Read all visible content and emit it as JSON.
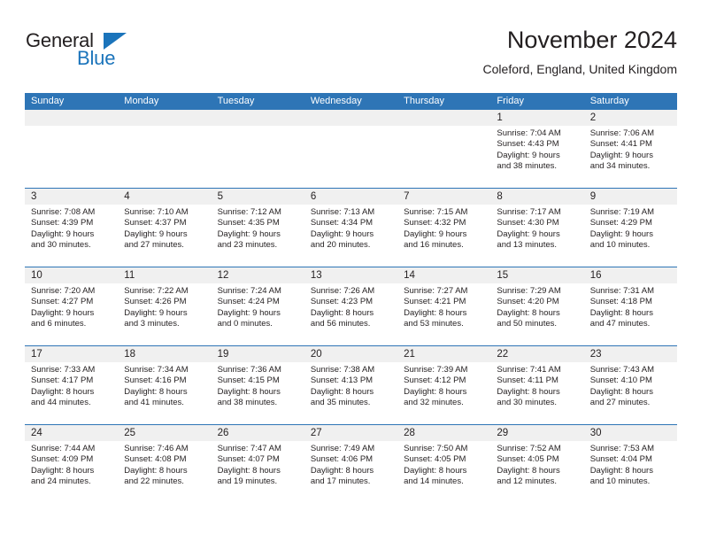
{
  "brand": {
    "name_top": "General",
    "name_bottom": "Blue",
    "accent_color": "#1b74bb"
  },
  "header": {
    "title": "November 2024",
    "location": "Coleford, England, United Kingdom"
  },
  "calendar": {
    "header_color": "#2e75b6",
    "daynum_band_color": "#f0f0f0",
    "day_names": [
      "Sunday",
      "Monday",
      "Tuesday",
      "Wednesday",
      "Thursday",
      "Friday",
      "Saturday"
    ],
    "weeks": [
      [
        {
          "day": "",
          "sunrise": "",
          "sunset": "",
          "daylight1": "",
          "daylight2": ""
        },
        {
          "day": "",
          "sunrise": "",
          "sunset": "",
          "daylight1": "",
          "daylight2": ""
        },
        {
          "day": "",
          "sunrise": "",
          "sunset": "",
          "daylight1": "",
          "daylight2": ""
        },
        {
          "day": "",
          "sunrise": "",
          "sunset": "",
          "daylight1": "",
          "daylight2": ""
        },
        {
          "day": "",
          "sunrise": "",
          "sunset": "",
          "daylight1": "",
          "daylight2": ""
        },
        {
          "day": "1",
          "sunrise": "Sunrise: 7:04 AM",
          "sunset": "Sunset: 4:43 PM",
          "daylight1": "Daylight: 9 hours",
          "daylight2": "and 38 minutes."
        },
        {
          "day": "2",
          "sunrise": "Sunrise: 7:06 AM",
          "sunset": "Sunset: 4:41 PM",
          "daylight1": "Daylight: 9 hours",
          "daylight2": "and 34 minutes."
        }
      ],
      [
        {
          "day": "3",
          "sunrise": "Sunrise: 7:08 AM",
          "sunset": "Sunset: 4:39 PM",
          "daylight1": "Daylight: 9 hours",
          "daylight2": "and 30 minutes."
        },
        {
          "day": "4",
          "sunrise": "Sunrise: 7:10 AM",
          "sunset": "Sunset: 4:37 PM",
          "daylight1": "Daylight: 9 hours",
          "daylight2": "and 27 minutes."
        },
        {
          "day": "5",
          "sunrise": "Sunrise: 7:12 AM",
          "sunset": "Sunset: 4:35 PM",
          "daylight1": "Daylight: 9 hours",
          "daylight2": "and 23 minutes."
        },
        {
          "day": "6",
          "sunrise": "Sunrise: 7:13 AM",
          "sunset": "Sunset: 4:34 PM",
          "daylight1": "Daylight: 9 hours",
          "daylight2": "and 20 minutes."
        },
        {
          "day": "7",
          "sunrise": "Sunrise: 7:15 AM",
          "sunset": "Sunset: 4:32 PM",
          "daylight1": "Daylight: 9 hours",
          "daylight2": "and 16 minutes."
        },
        {
          "day": "8",
          "sunrise": "Sunrise: 7:17 AM",
          "sunset": "Sunset: 4:30 PM",
          "daylight1": "Daylight: 9 hours",
          "daylight2": "and 13 minutes."
        },
        {
          "day": "9",
          "sunrise": "Sunrise: 7:19 AM",
          "sunset": "Sunset: 4:29 PM",
          "daylight1": "Daylight: 9 hours",
          "daylight2": "and 10 minutes."
        }
      ],
      [
        {
          "day": "10",
          "sunrise": "Sunrise: 7:20 AM",
          "sunset": "Sunset: 4:27 PM",
          "daylight1": "Daylight: 9 hours",
          "daylight2": "and 6 minutes."
        },
        {
          "day": "11",
          "sunrise": "Sunrise: 7:22 AM",
          "sunset": "Sunset: 4:26 PM",
          "daylight1": "Daylight: 9 hours",
          "daylight2": "and 3 minutes."
        },
        {
          "day": "12",
          "sunrise": "Sunrise: 7:24 AM",
          "sunset": "Sunset: 4:24 PM",
          "daylight1": "Daylight: 9 hours",
          "daylight2": "and 0 minutes."
        },
        {
          "day": "13",
          "sunrise": "Sunrise: 7:26 AM",
          "sunset": "Sunset: 4:23 PM",
          "daylight1": "Daylight: 8 hours",
          "daylight2": "and 56 minutes."
        },
        {
          "day": "14",
          "sunrise": "Sunrise: 7:27 AM",
          "sunset": "Sunset: 4:21 PM",
          "daylight1": "Daylight: 8 hours",
          "daylight2": "and 53 minutes."
        },
        {
          "day": "15",
          "sunrise": "Sunrise: 7:29 AM",
          "sunset": "Sunset: 4:20 PM",
          "daylight1": "Daylight: 8 hours",
          "daylight2": "and 50 minutes."
        },
        {
          "day": "16",
          "sunrise": "Sunrise: 7:31 AM",
          "sunset": "Sunset: 4:18 PM",
          "daylight1": "Daylight: 8 hours",
          "daylight2": "and 47 minutes."
        }
      ],
      [
        {
          "day": "17",
          "sunrise": "Sunrise: 7:33 AM",
          "sunset": "Sunset: 4:17 PM",
          "daylight1": "Daylight: 8 hours",
          "daylight2": "and 44 minutes."
        },
        {
          "day": "18",
          "sunrise": "Sunrise: 7:34 AM",
          "sunset": "Sunset: 4:16 PM",
          "daylight1": "Daylight: 8 hours",
          "daylight2": "and 41 minutes."
        },
        {
          "day": "19",
          "sunrise": "Sunrise: 7:36 AM",
          "sunset": "Sunset: 4:15 PM",
          "daylight1": "Daylight: 8 hours",
          "daylight2": "and 38 minutes."
        },
        {
          "day": "20",
          "sunrise": "Sunrise: 7:38 AM",
          "sunset": "Sunset: 4:13 PM",
          "daylight1": "Daylight: 8 hours",
          "daylight2": "and 35 minutes."
        },
        {
          "day": "21",
          "sunrise": "Sunrise: 7:39 AM",
          "sunset": "Sunset: 4:12 PM",
          "daylight1": "Daylight: 8 hours",
          "daylight2": "and 32 minutes."
        },
        {
          "day": "22",
          "sunrise": "Sunrise: 7:41 AM",
          "sunset": "Sunset: 4:11 PM",
          "daylight1": "Daylight: 8 hours",
          "daylight2": "and 30 minutes."
        },
        {
          "day": "23",
          "sunrise": "Sunrise: 7:43 AM",
          "sunset": "Sunset: 4:10 PM",
          "daylight1": "Daylight: 8 hours",
          "daylight2": "and 27 minutes."
        }
      ],
      [
        {
          "day": "24",
          "sunrise": "Sunrise: 7:44 AM",
          "sunset": "Sunset: 4:09 PM",
          "daylight1": "Daylight: 8 hours",
          "daylight2": "and 24 minutes."
        },
        {
          "day": "25",
          "sunrise": "Sunrise: 7:46 AM",
          "sunset": "Sunset: 4:08 PM",
          "daylight1": "Daylight: 8 hours",
          "daylight2": "and 22 minutes."
        },
        {
          "day": "26",
          "sunrise": "Sunrise: 7:47 AM",
          "sunset": "Sunset: 4:07 PM",
          "daylight1": "Daylight: 8 hours",
          "daylight2": "and 19 minutes."
        },
        {
          "day": "27",
          "sunrise": "Sunrise: 7:49 AM",
          "sunset": "Sunset: 4:06 PM",
          "daylight1": "Daylight: 8 hours",
          "daylight2": "and 17 minutes."
        },
        {
          "day": "28",
          "sunrise": "Sunrise: 7:50 AM",
          "sunset": "Sunset: 4:05 PM",
          "daylight1": "Daylight: 8 hours",
          "daylight2": "and 14 minutes."
        },
        {
          "day": "29",
          "sunrise": "Sunrise: 7:52 AM",
          "sunset": "Sunset: 4:05 PM",
          "daylight1": "Daylight: 8 hours",
          "daylight2": "and 12 minutes."
        },
        {
          "day": "30",
          "sunrise": "Sunrise: 7:53 AM",
          "sunset": "Sunset: 4:04 PM",
          "daylight1": "Daylight: 8 hours",
          "daylight2": "and 10 minutes."
        }
      ]
    ]
  }
}
